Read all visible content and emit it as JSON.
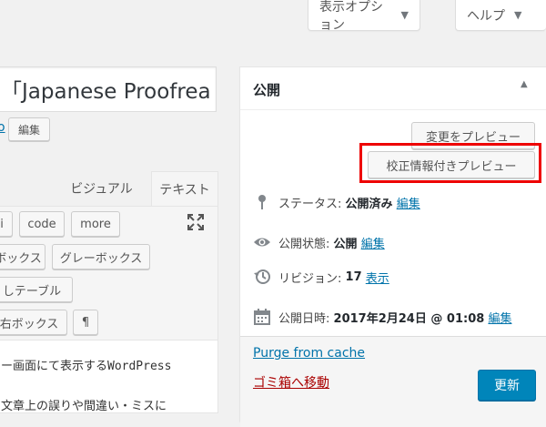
{
  "screen_meta": {
    "screen_options_label": "表示オプション",
    "help_label": "ヘルプ",
    "caret": "▼"
  },
  "title_field": {
    "value": "「Japanese Proofreac"
  },
  "permalink": {
    "link_fragment": "o",
    "edit_label": "編集"
  },
  "editor": {
    "tabs": [
      {
        "label": "ビジュアル"
      },
      {
        "label": "テキスト"
      }
    ],
    "quicktags": [
      "i",
      "code",
      "more",
      "ボックス",
      "グレーボックス",
      "しテーブル",
      "右ボックス",
      "¶"
    ],
    "lines": [
      "ー画面にて表示するWordPress",
      "文章上の誤りや間違い・ミスに"
    ]
  },
  "publish_box": {
    "title": "公開",
    "toggle": "▲",
    "preview_changes_label": "変更をプレビュー",
    "proofread_preview_label": "校正情報付きプレビュー",
    "status_label": "ステータス:",
    "status_value": "公開済み",
    "visibility_label": "公開状態:",
    "visibility_value": "公開",
    "revisions_label": "リビジョン:",
    "revisions_value": "17",
    "revisions_link": "表示",
    "date_label": "公開日時:",
    "date_value": "2017年2月24日 @ 01:08",
    "edit_label": "編集",
    "purge_cache_label": "Purge from cache",
    "trash_label": "ゴミ箱へ移動",
    "update_label": "更新"
  },
  "colors": {
    "accent": "#0085ba",
    "link": "#0073aa",
    "trash": "#a00",
    "highlight": "#e00000"
  }
}
